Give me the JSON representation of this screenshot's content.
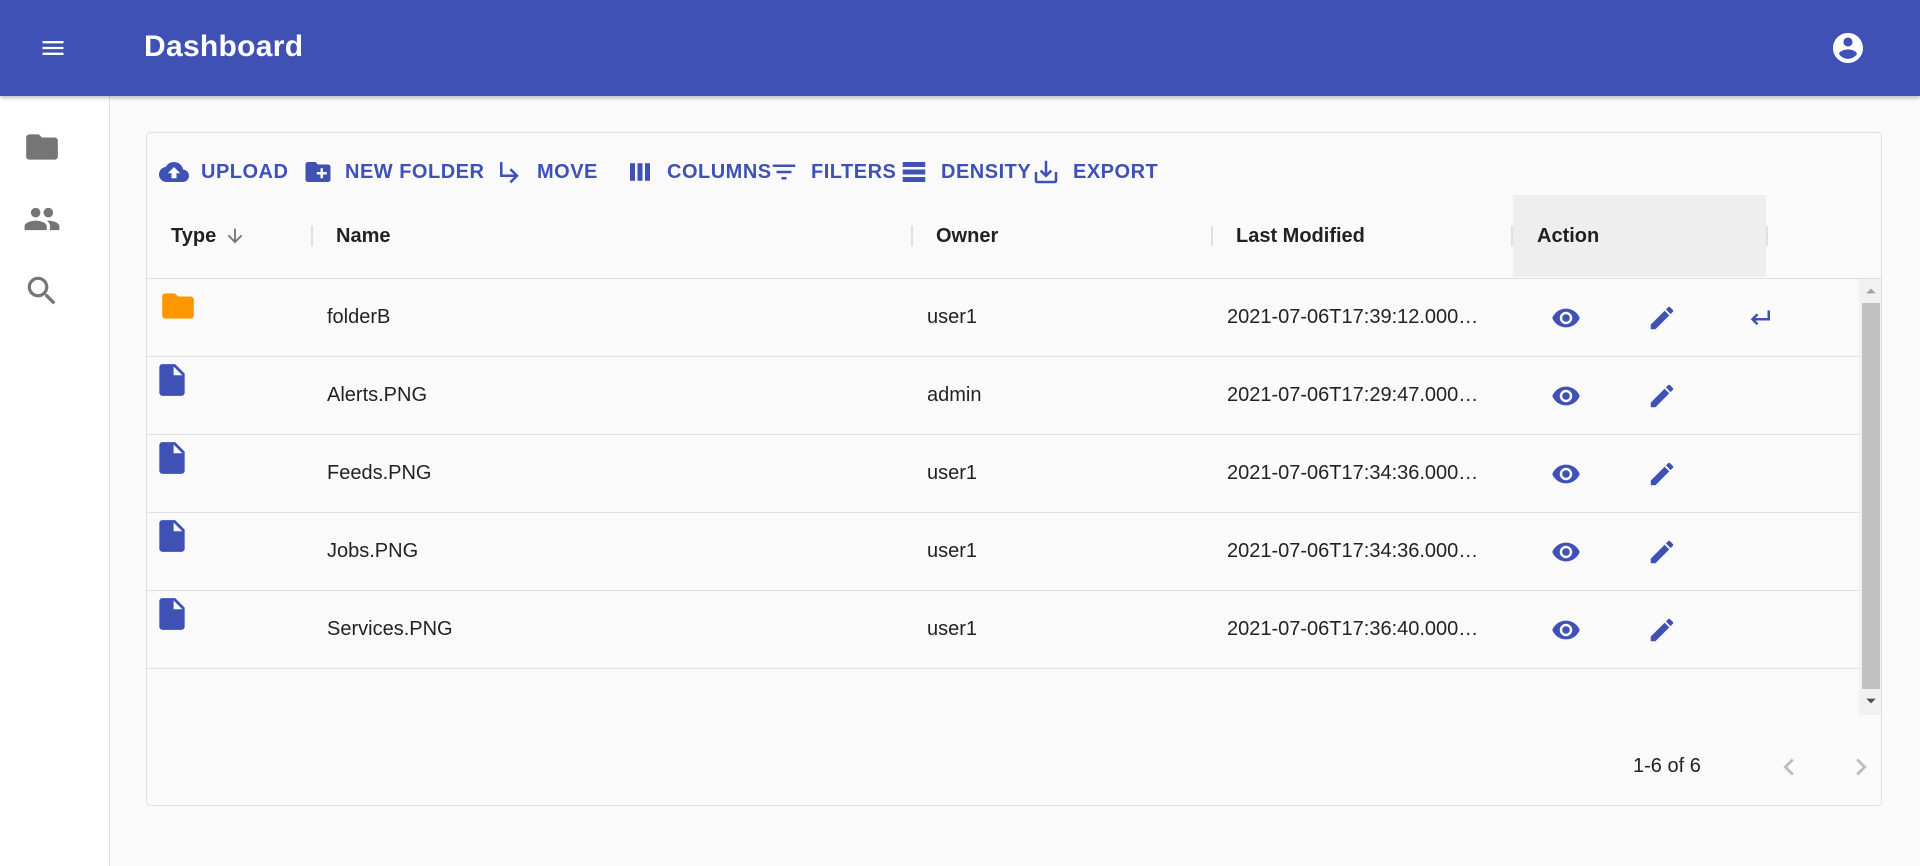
{
  "appbar": {
    "title": "Dashboard"
  },
  "toolbar": {
    "upload": "UPLOAD",
    "new_folder": "NEW FOLDER",
    "move": "MOVE",
    "columns": "COLUMNS",
    "filters": "FILTERS",
    "density": "DENSITY",
    "export": "EXPORT"
  },
  "columns": {
    "type": "Type",
    "name": "Name",
    "owner": "Owner",
    "modified": "Last Modified",
    "action": "Action"
  },
  "rows": [
    {
      "type": "folder",
      "name": "folderB",
      "owner": "user1",
      "modified": "2021-07-06T17:39:12.000…"
    },
    {
      "type": "file",
      "name": "Alerts.PNG",
      "owner": "admin",
      "modified": "2021-07-06T17:29:47.000…"
    },
    {
      "type": "file",
      "name": "Feeds.PNG",
      "owner": "user1",
      "modified": "2021-07-06T17:34:36.000…"
    },
    {
      "type": "file",
      "name": "Jobs.PNG",
      "owner": "user1",
      "modified": "2021-07-06T17:34:36.000…"
    },
    {
      "type": "file",
      "name": "Services.PNG",
      "owner": "user1",
      "modified": "2021-07-06T17:36:40.000…"
    }
  ],
  "pagination": {
    "range": "1-6 of 6"
  },
  "colors": {
    "primary": "#3f51b5",
    "folder": "#ff9800",
    "text": "#212121",
    "muted": "#757575"
  }
}
